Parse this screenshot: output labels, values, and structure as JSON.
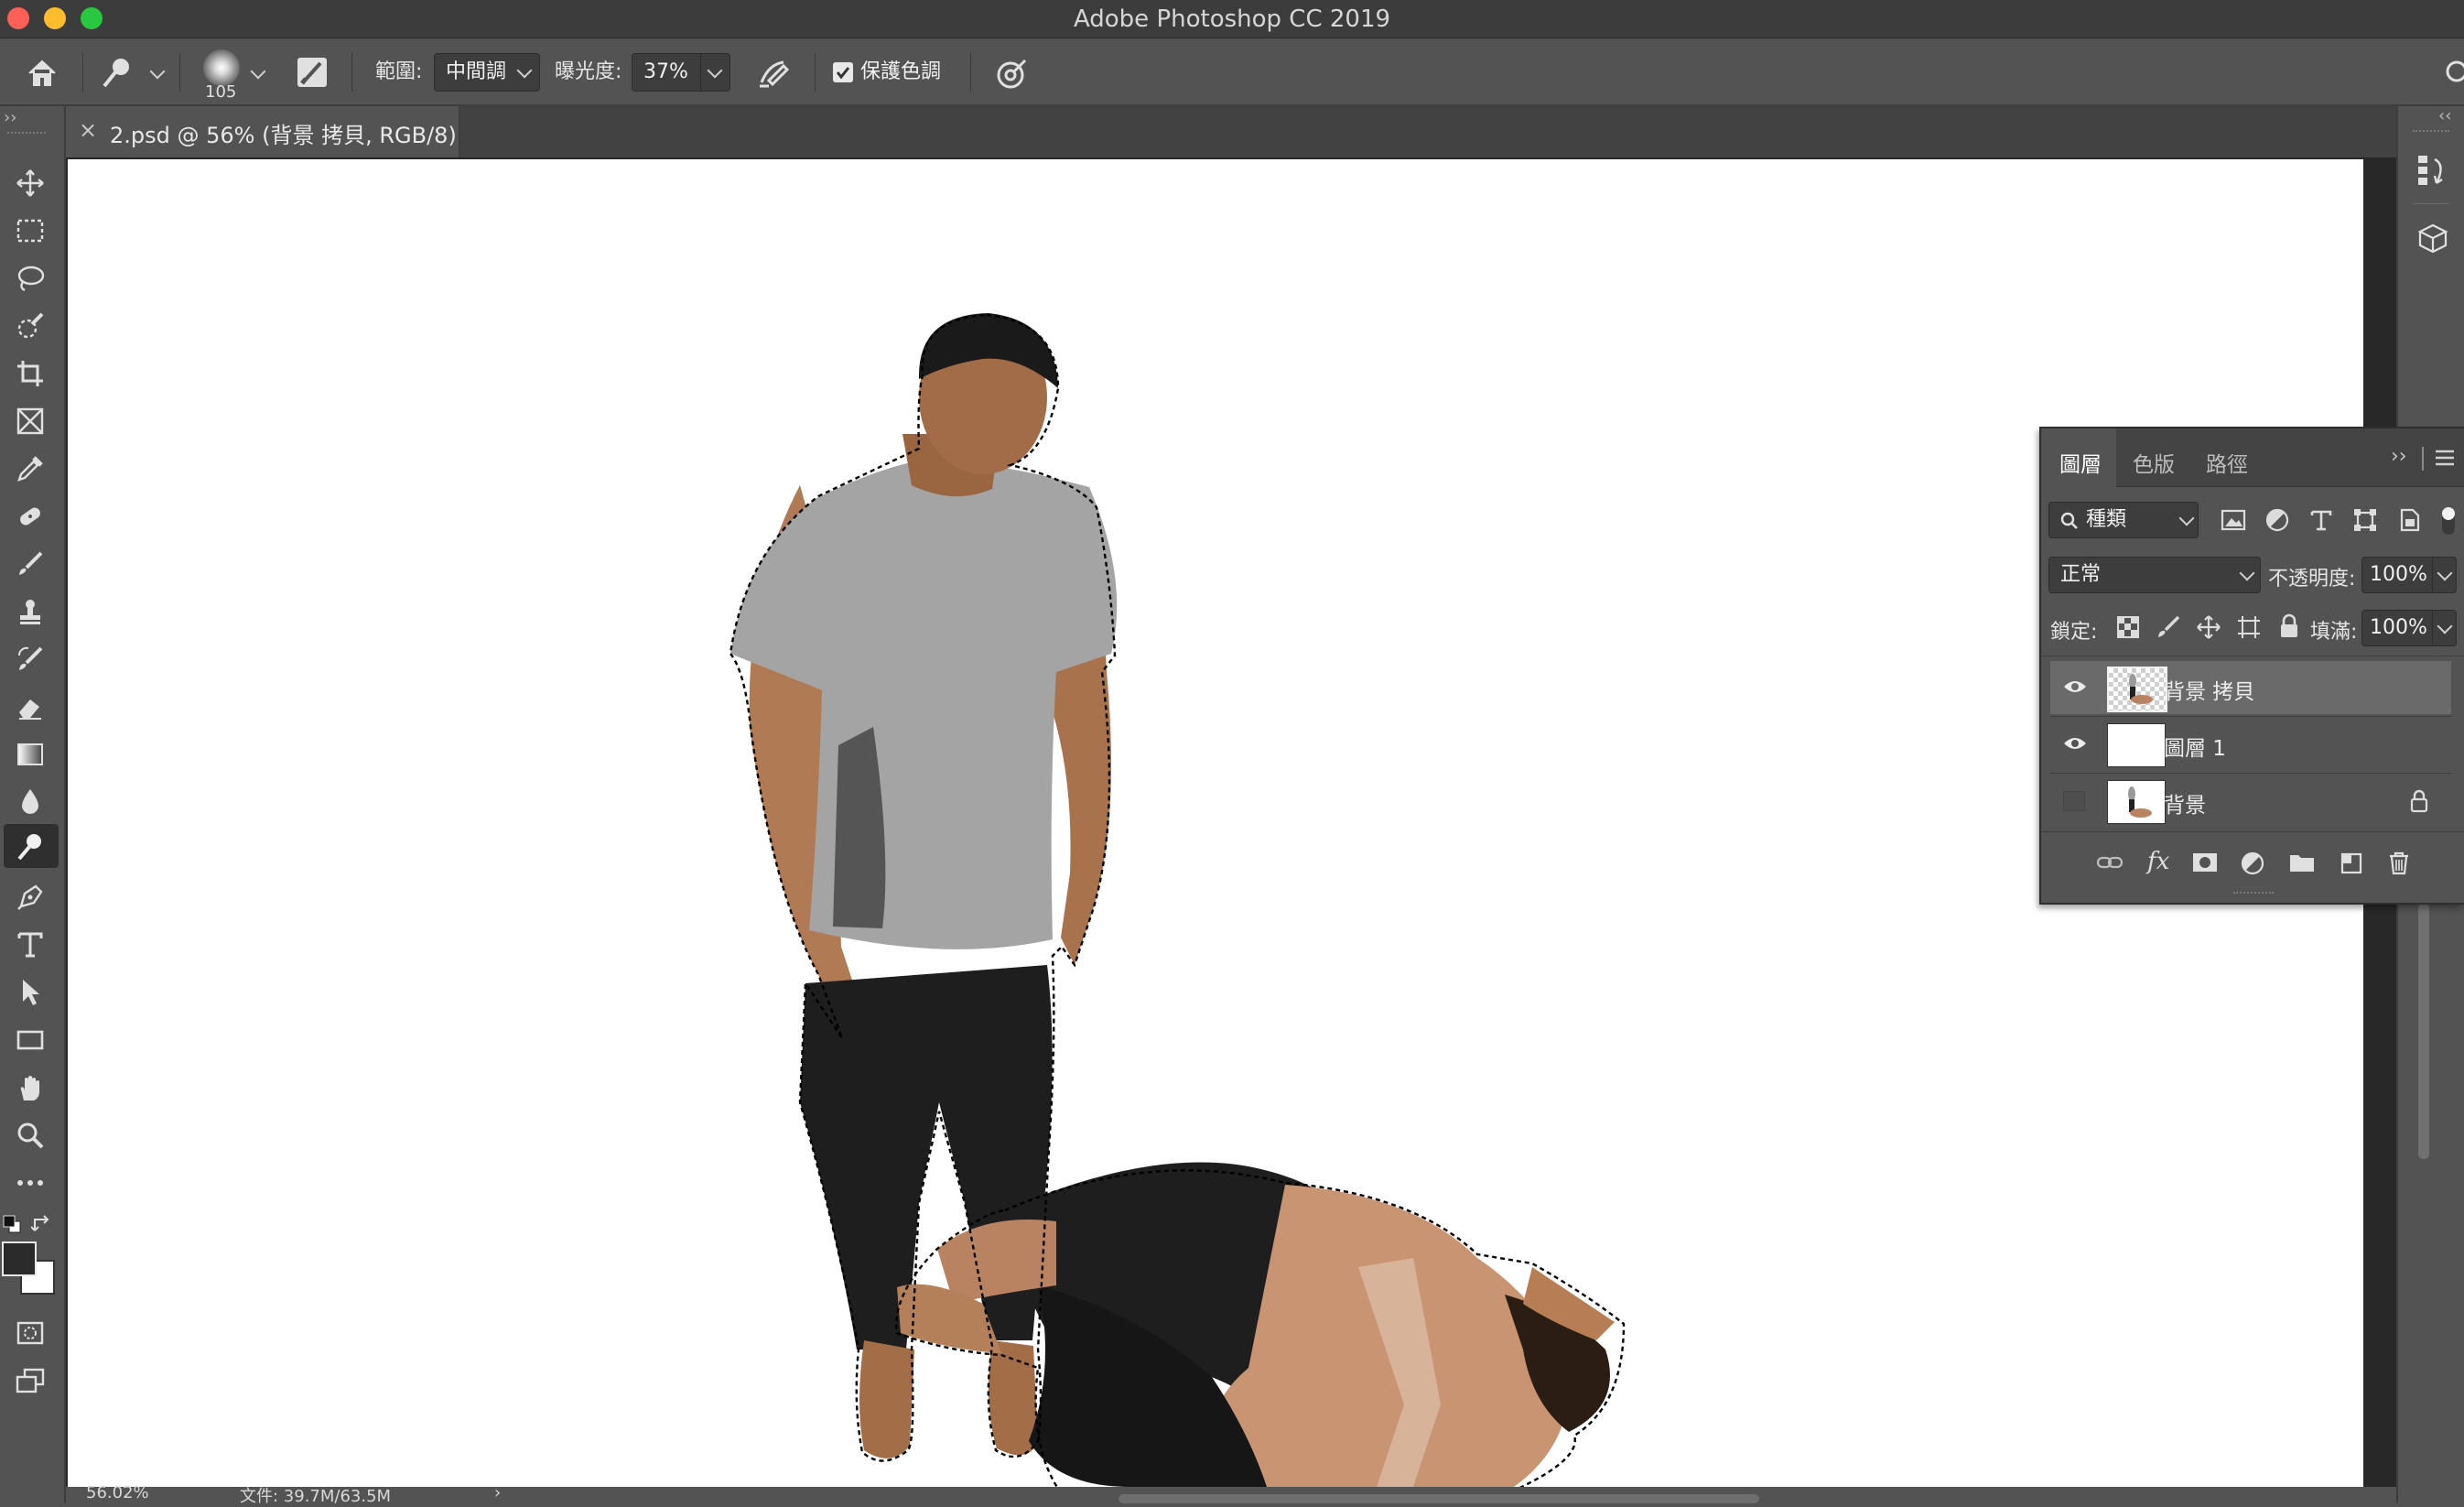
{
  "app": {
    "window_title": "Adobe Photoshop CC 2019"
  },
  "options_bar": {
    "brush_size": "105",
    "range_label": "範圍:",
    "range_value": "中間調",
    "exposure_label": "曝光度:",
    "exposure_value": "37%",
    "protect_tones_label": "保護色調",
    "protect_tones_checked": true
  },
  "document": {
    "tab_title": "2.psd @ 56% (背景 拷貝, RGB/8)",
    "close_glyph": "×"
  },
  "status": {
    "zoom": "56.02%",
    "doc_size": "文件: 39.7M/63.5M",
    "arrow": "›"
  },
  "layers_panel": {
    "tabs": [
      {
        "label": "圖層",
        "active": true
      },
      {
        "label": "色版",
        "active": false
      },
      {
        "label": "路徑",
        "active": false
      }
    ],
    "filter_kind": "種類",
    "blend_mode": "正常",
    "opacity_label": "不透明度:",
    "opacity_value": "100%",
    "lock_label": "鎖定:",
    "fill_label": "填滿:",
    "fill_value": "100%",
    "layers": [
      {
        "name": "背景 拷貝",
        "visible": true,
        "selected": true,
        "locked": false
      },
      {
        "name": "圖層 1",
        "visible": true,
        "selected": false,
        "locked": false
      },
      {
        "name": "背景",
        "visible": false,
        "selected": false,
        "locked": true
      }
    ]
  },
  "colors": {
    "ui_gray": "#535353",
    "canvas": "#ffffff",
    "traffic_close": "#fe5f57",
    "traffic_minimize": "#febc2e",
    "traffic_zoom": "#28c840"
  }
}
